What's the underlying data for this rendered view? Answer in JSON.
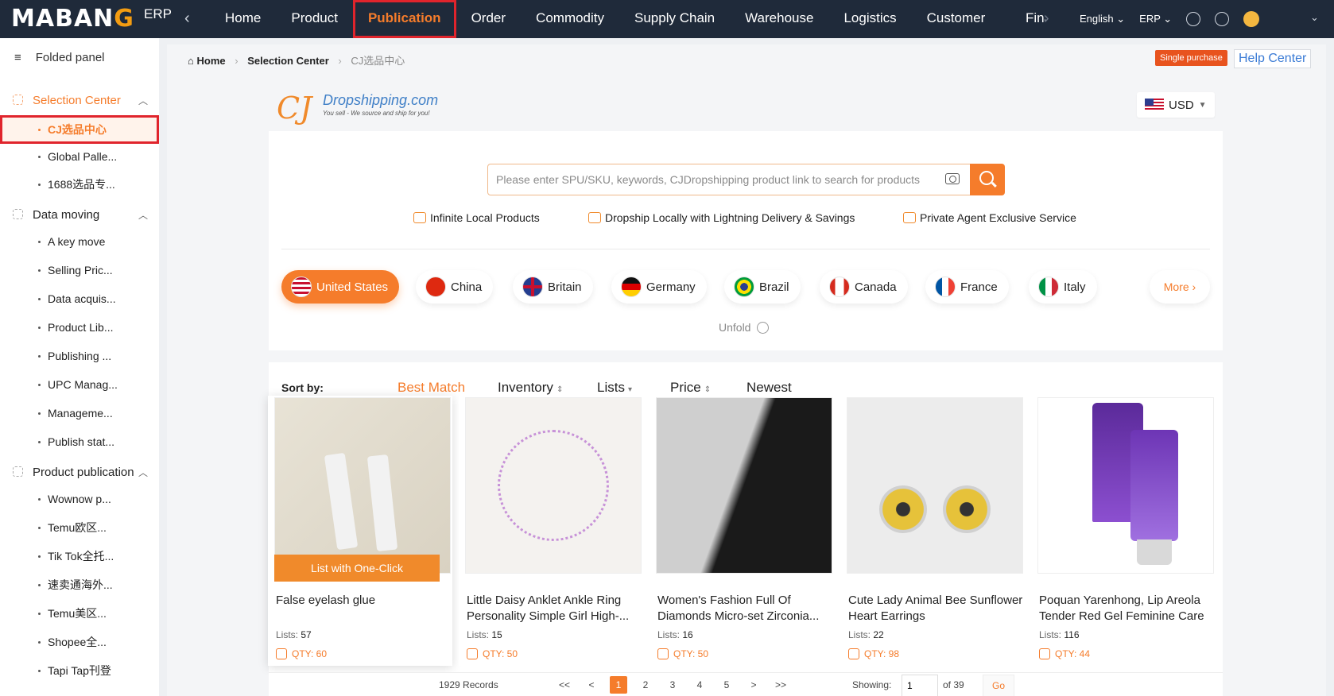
{
  "app": {
    "logo_text": "MABANG",
    "erp_label": "ERP"
  },
  "top_nav": {
    "items": [
      {
        "label": "Home"
      },
      {
        "label": "Product"
      },
      {
        "label": "Publication"
      },
      {
        "label": "Order"
      },
      {
        "label": "Commodity"
      },
      {
        "label": "Supply Chain"
      },
      {
        "label": "Warehouse"
      },
      {
        "label": "Logistics"
      },
      {
        "label": "Customer"
      },
      {
        "label": "Fina"
      }
    ],
    "active": "Publication",
    "language": "English",
    "system": "ERP",
    "icons": [
      "bell-icon",
      "help-icon",
      "avatar",
      "chevron-down-icon"
    ]
  },
  "sidebar": {
    "folded_label": "Folded panel",
    "sections": [
      {
        "label": "Selection Center",
        "active": true,
        "items": [
          "CJ选品中心",
          "Global Palle...",
          "1688选品专..."
        ]
      },
      {
        "label": "Data moving",
        "items": [
          "A key move",
          "Selling Pric...",
          "Data acquis...",
          "Product Lib...",
          "Publishing ...",
          "UPC Manag...",
          "Manageme...",
          "Publish stat..."
        ]
      },
      {
        "label": "Product publication",
        "items": [
          "Wownow p...",
          "Temu欧区...",
          "Tik Tok全托...",
          "速卖通海外...",
          "Temu美区...",
          "Shopee全...",
          "Tapi Tap刊登"
        ]
      }
    ],
    "active_item": "CJ选品中心"
  },
  "breadcrumb": {
    "home": "Home",
    "section": "Selection Center",
    "current": "CJ选品中心"
  },
  "header_buttons": {
    "single_purchase": "Single purchase",
    "help_center": "Help Center"
  },
  "cj": {
    "logo_mark": "CJ",
    "logo_name": "Dropshipping.com",
    "logo_tagline": "You sell - We source and ship for you!",
    "currency": "USD"
  },
  "search": {
    "placeholder": "Please enter SPU/SKU, keywords, CJDropshipping product link to search for products",
    "value": ""
  },
  "features": [
    "Infinite Local Products",
    "Dropship Locally with Lightning Delivery & Savings",
    "Private Agent Exclusive Service"
  ],
  "countries": [
    "United States",
    "China",
    "Britain",
    "Germany",
    "Brazil",
    "Canada",
    "France",
    "Italy"
  ],
  "active_country": "United States",
  "more_label": "More",
  "unfold_label": "Unfold",
  "sort": {
    "label": "Sort by:",
    "options": [
      "Best Match",
      "Inventory",
      "Lists",
      "Price",
      "Newest"
    ],
    "active": "Best Match"
  },
  "products": [
    {
      "title": "False eyelash glue",
      "lists_label": "Lists:",
      "lists": "57",
      "qty": "QTY: 60",
      "action": "List with One-Click"
    },
    {
      "title": "Little Daisy Anklet Ankle Ring Personality Simple Girl High-...",
      "lists_label": "Lists:",
      "lists": "15",
      "qty": "QTY: 50"
    },
    {
      "title": "Women's Fashion Full Of Diamonds Micro-set Zirconia...",
      "lists_label": "Lists:",
      "lists": "16",
      "qty": "QTY: 50"
    },
    {
      "title": "Cute Lady Animal Bee Sunflower Heart Earrings",
      "lists_label": "Lists:",
      "lists": "22",
      "qty": "QTY: 98"
    },
    {
      "title": "Poquan Yarenhong, Lip Areola Tender Red Gel Feminine Care",
      "lists_label": "Lists:",
      "lists": "116",
      "qty": "QTY: 44"
    }
  ],
  "pagination": {
    "records": "1929 Records",
    "first": "<<",
    "prev": "<",
    "pages": [
      "1",
      "2",
      "3",
      "4",
      "5"
    ],
    "current": "1",
    "next": ">",
    "last": ">>",
    "showing_label": "Showing:",
    "page_input": "1",
    "of_total": "of 39",
    "go": "Go"
  },
  "colors": {
    "accent": "#f57c2b",
    "topbar": "#1f2a3a",
    "highlight_box": "#e0242c"
  }
}
